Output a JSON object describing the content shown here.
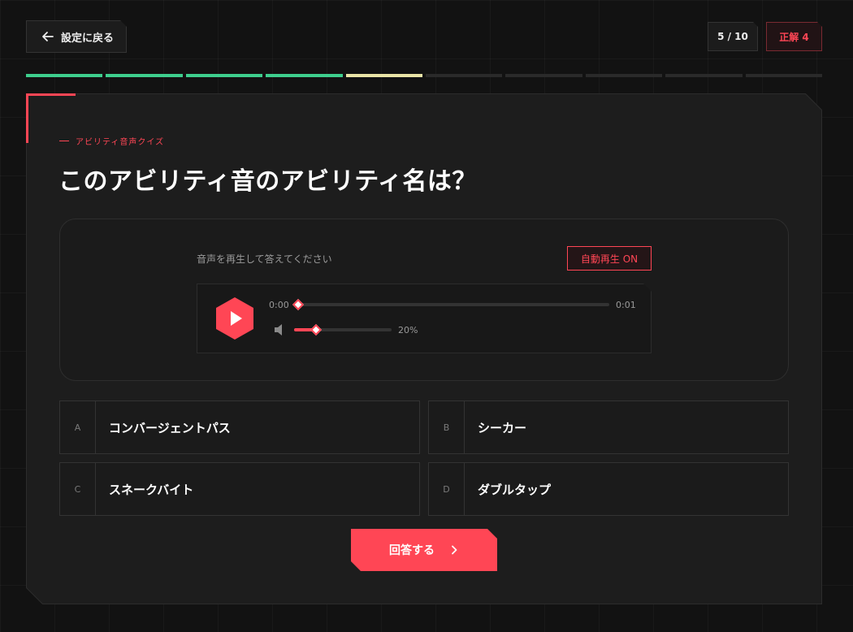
{
  "header": {
    "back_label": "設定に戻る",
    "counter": "5 / 10",
    "score": "正解 4"
  },
  "progress": {
    "total": 10,
    "segments": [
      "correct",
      "correct",
      "correct",
      "correct",
      "current",
      "pending",
      "pending",
      "pending",
      "pending",
      "pending"
    ]
  },
  "quiz": {
    "eyebrow": "アビリティ音声クイズ",
    "question": "このアビリティ音のアビリティ名は？"
  },
  "audio": {
    "hint": "音声を再生して答えてください",
    "autoplay_label": "自動再生 ON",
    "time_current": "0:00",
    "time_total": "0:01",
    "volume_label": "20%",
    "seek_fraction": 0,
    "volume_fraction": 0.2
  },
  "options": [
    {
      "letter": "A",
      "text": "コンバージェントパス"
    },
    {
      "letter": "B",
      "text": "シーカー"
    },
    {
      "letter": "C",
      "text": "スネークバイト"
    },
    {
      "letter": "D",
      "text": "ダブルタップ"
    }
  ],
  "submit_label": "回答する",
  "colors": {
    "accent": "#ff4655",
    "correct": "#3ecf8e",
    "current": "#e9e4a6",
    "pending": "#2a2a2a",
    "background": "#121212",
    "card": "#1d1d1d"
  },
  "icons": {
    "back": "arrow-left-icon",
    "play": "play-icon",
    "volume": "volume-icon",
    "submit": "chevron-right-icon"
  }
}
